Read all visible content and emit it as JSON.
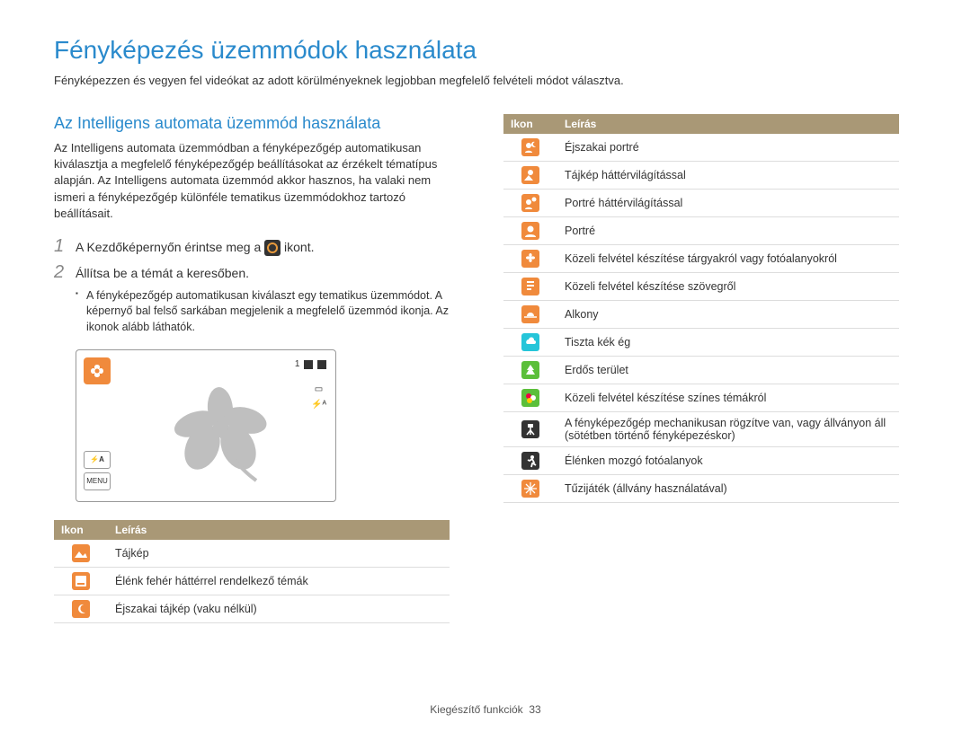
{
  "page": {
    "title": "Fényképezés üzemmódok használata",
    "intro": "Fényképezzen és vegyen fel videókat az adott körülményeknek legjobban megfelelő felvételi módot választva.",
    "footer_section": "Kiegészítő funkciók",
    "footer_page": "33"
  },
  "section": {
    "title": "Az Intelligens automata üzemmód használata",
    "desc": "Az Intelligens automata üzemmódban a fényképezőgép automatikusan kiválasztja a megfelelő fényképezőgép beállításokat az érzékelt tématípus alapján. Az Intelligens automata üzemmód akkor hasznos, ha valaki nem ismeri a fényképezőgép különféle tematikus üzemmódokhoz tartozó beállításait."
  },
  "steps": {
    "s1_num": "1",
    "s1_pre": "A Kezdőképernyőn érintse meg a ",
    "s1_post": " ikont.",
    "s2_num": "2",
    "s2_text": "Állítsa be a témát a keresőben.",
    "s2_bullet": "A fényképezőgép automatikusan kiválaszt egy tematikus üzemmódot. A képernyő bal felső sarkában megjelenik a megfelelő üzemmód ikonja. Az ikonok alább láthatók."
  },
  "screenshot": {
    "counter": "1",
    "menu_label": "MENU",
    "flash_label": "⚡A"
  },
  "table_headers": {
    "icon": "Ikon",
    "desc": "Leírás"
  },
  "left_table": [
    {
      "color": "#f08a3c",
      "svg": "landscape",
      "label": "Tájkép"
    },
    {
      "color": "#f08a3c",
      "svg": "whitebg",
      "label": "Élénk fehér háttérrel rendelkező témák"
    },
    {
      "color": "#f08a3c",
      "svg": "nightland",
      "label": "Éjszakai tájkép (vaku nélkül)"
    }
  ],
  "right_table": [
    {
      "color": "#f08a3c",
      "svg": "nightportrait",
      "label": "Éjszakai portré"
    },
    {
      "color": "#f08a3c",
      "svg": "backlitland",
      "label": "Tájkép háttérvilágítással"
    },
    {
      "color": "#f08a3c",
      "svg": "backlitport",
      "label": "Portré háttérvilágítással"
    },
    {
      "color": "#f08a3c",
      "svg": "portrait",
      "label": "Portré"
    },
    {
      "color": "#f08a3c",
      "svg": "macro",
      "label": "Közeli felvétel készítése tárgyakról vagy fotóalanyokról"
    },
    {
      "color": "#f08a3c",
      "svg": "macrotext",
      "label": "Közeli felvétel készítése szövegről"
    },
    {
      "color": "#f08a3c",
      "svg": "sunset",
      "label": "Alkony"
    },
    {
      "color": "#25c5d9",
      "svg": "bluesky",
      "label": "Tiszta kék ég"
    },
    {
      "color": "#5bbf3a",
      "svg": "forest",
      "label": "Erdős terület"
    },
    {
      "color": "#5bbf3a",
      "svg": "macrocolor",
      "label": "Közeli felvétel készítése színes témákról"
    },
    {
      "color": "#333333",
      "svg": "tripod",
      "label": "A fényképezőgép mechanikusan rögzítve van, vagy állványon áll (sötétben történő fényképezéskor)"
    },
    {
      "color": "#333333",
      "svg": "action",
      "label": "Élénken mozgó fotóalanyok"
    },
    {
      "color": "#f08a3c",
      "svg": "fireworks",
      "label": "Tűzijáték (állvány használatával)"
    }
  ]
}
